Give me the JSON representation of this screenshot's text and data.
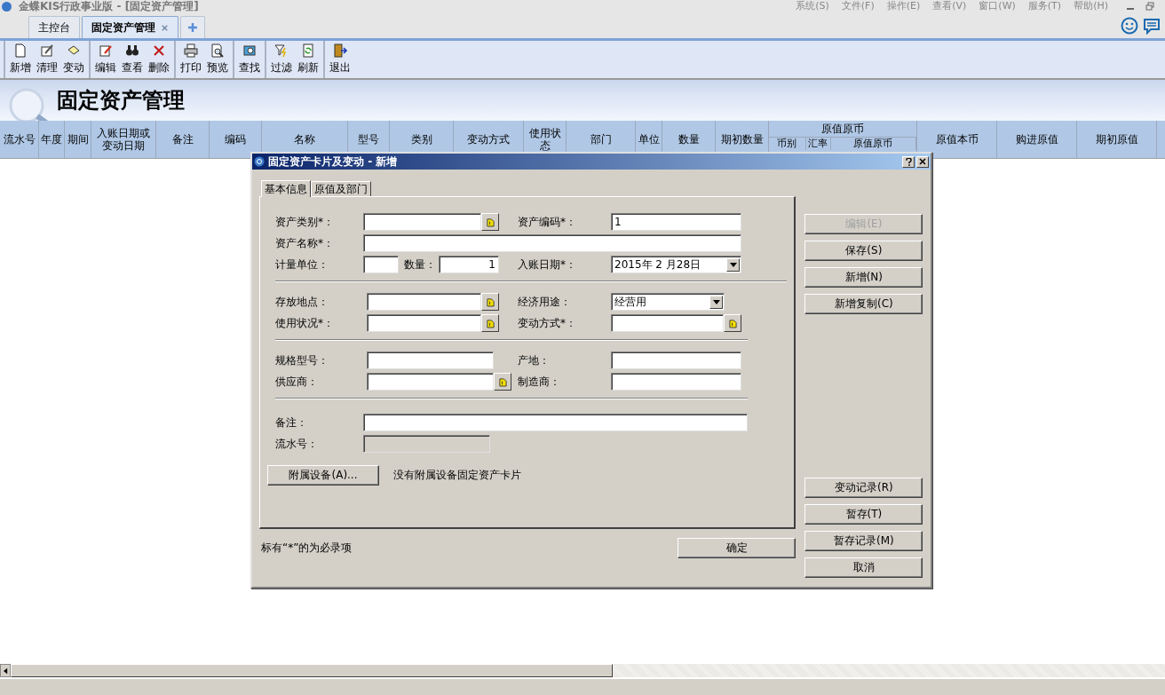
{
  "app": {
    "title": "金蝶KIS行政事业版 - [固定资产管理]",
    "menu": [
      "系统(S)",
      "文件(F)",
      "操作(E)",
      "查看(V)",
      "窗口(W)",
      "服务(T)",
      "帮助(H)"
    ]
  },
  "tabs": [
    {
      "label": "主控台",
      "selected": false
    },
    {
      "label": "固定资产管理",
      "selected": true
    }
  ],
  "toolbar": [
    [
      {
        "label": "新增"
      },
      {
        "label": "清理"
      },
      {
        "label": "变动"
      }
    ],
    [
      {
        "label": "编辑"
      },
      {
        "label": "查看"
      },
      {
        "label": "删除"
      }
    ],
    [
      {
        "label": "打印"
      },
      {
        "label": "预览"
      }
    ],
    [
      {
        "label": "查找"
      }
    ],
    [
      {
        "label": "过滤"
      },
      {
        "label": "刷新"
      }
    ],
    [
      {
        "label": "退出"
      }
    ]
  ],
  "page_title": "固定资产管理",
  "table": {
    "columns": [
      {
        "label": "流水号"
      },
      {
        "label": "年度"
      },
      {
        "label": "期间"
      },
      {
        "label": "入账日期或变动日期"
      },
      {
        "label": "备注"
      },
      {
        "label": "编码"
      },
      {
        "label": "名称"
      },
      {
        "label": "型号"
      },
      {
        "label": "类别"
      },
      {
        "label": "变动方式"
      },
      {
        "label": "使用状态"
      },
      {
        "label": "部门"
      },
      {
        "label": "单位"
      },
      {
        "label": "数量"
      },
      {
        "label": "期初数量"
      },
      {
        "label": "原值原币",
        "children": [
          "币别",
          "汇率",
          "原值原币"
        ]
      },
      {
        "label": "原值本币"
      },
      {
        "label": "购进原值"
      },
      {
        "label": "期初原值"
      }
    ]
  },
  "dialog": {
    "title": "固定资产卡片及变动 - 新增",
    "tabs": [
      {
        "label": "基本信息",
        "selected": true
      },
      {
        "label": "原值及部门",
        "selected": false
      }
    ],
    "sections": [
      {
        "rows": [
          [
            {
              "fields": [
                {
                  "label": "资产类别*：",
                  "kind": "lookup"
                }
              ]
            },
            {
              "fields": [
                {
                  "label": "资产编码*：",
                  "kind": "text",
                  "value": "1"
                }
              ]
            }
          ],
          [
            {
              "fields": [
                {
                  "label": "资产名称*：",
                  "kind": "text"
                }
              ]
            }
          ],
          [
            {
              "fields": [
                {
                  "label": "计量单位：",
                  "kind": "short"
                },
                {
                  "label": "数量：",
                  "kind": "number",
                  "value": "1"
                }
              ]
            },
            {
              "fields": [
                {
                  "label": "入账日期*：",
                  "kind": "dropdown",
                  "value": "2015年 2 月28日"
                }
              ]
            }
          ]
        ]
      },
      {
        "rows": [
          [
            {
              "fields": [
                {
                  "label": "存放地点：",
                  "kind": "lookup"
                }
              ]
            },
            {
              "fields": [
                {
                  "label": "经济用途：",
                  "kind": "dropdown",
                  "value": "经营用"
                }
              ]
            }
          ],
          [
            {
              "fields": [
                {
                  "label": "使用状况*：",
                  "kind": "lookup"
                }
              ]
            },
            {
              "fields": [
                {
                  "label": "变动方式*：",
                  "kind": "lookup"
                }
              ]
            }
          ]
        ]
      },
      {
        "rows": [
          [
            {
              "fields": [
                {
                  "label": "规格型号：",
                  "kind": "text"
                }
              ]
            },
            {
              "fields": [
                {
                  "label": "产地：",
                  "kind": "text"
                }
              ]
            }
          ],
          [
            {
              "fields": [
                {
                  "label": "供应商：",
                  "kind": "lookup"
                }
              ]
            },
            {
              "fields": [
                {
                  "label": "制造商：",
                  "kind": "text"
                }
              ]
            }
          ]
        ]
      },
      {
        "rows": [
          [
            {
              "fields": [
                {
                  "label": "备注：",
                  "kind": "text"
                }
              ]
            }
          ],
          [
            {
              "fields": [
                {
                  "label": "流水号：",
                  "kind": "readonly"
                }
              ]
            }
          ]
        ]
      }
    ],
    "attach_button": "附属设备(A)...",
    "attach_note": "没有附属设备固定资产卡片",
    "side_buttons_top": [
      {
        "label": "编辑(E)",
        "disabled": true
      },
      {
        "label": "保存(S)",
        "disabled": false
      },
      {
        "label": "新增(N)",
        "disabled": false
      },
      {
        "label": "新增复制(C)",
        "disabled": false
      }
    ],
    "side_buttons_bottom": [
      {
        "label": "变动记录(R)",
        "disabled": false
      },
      {
        "label": "暂存(T)",
        "disabled": false
      },
      {
        "label": "暂存记录(M)",
        "disabled": false
      }
    ],
    "required_note": "标有“*”的为必录项",
    "ok_button": "确定",
    "cancel_button": "取消"
  }
}
